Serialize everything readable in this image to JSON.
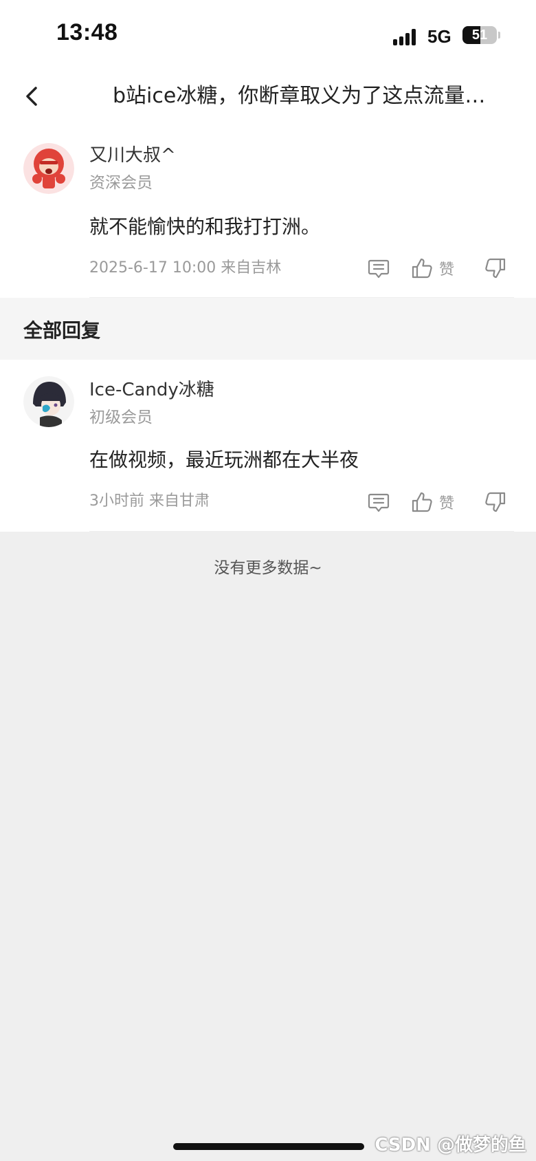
{
  "status_bar": {
    "time": "13:48",
    "network": "5G",
    "battery_level": "51",
    "battery_fraction": 0.51
  },
  "header": {
    "back_icon": "chevron-left-icon",
    "title": "b站ice冰糖，你断章取义为了这点流量…"
  },
  "main_comment": {
    "avatar_icon": "red-cartoon-avatar",
    "username": "又川大叔^",
    "member_level": "资深会员",
    "text": "就不能愉快的和我打打洲。",
    "meta": "2025-6-17 10:00  来自吉林",
    "reply_icon": "comment-icon",
    "like_icon": "thumbs-up-icon",
    "like_label": "赞",
    "dislike_icon": "thumbs-down-icon"
  },
  "replies_section": {
    "title": "全部回复"
  },
  "replies": [
    {
      "avatar_icon": "anime-girl-avatar",
      "username": "Ice-Candy冰糖",
      "member_level": "初级会员",
      "text": "在做视频，最近玩洲都在大半夜",
      "meta": "3小时前 来自甘肃",
      "reply_icon": "comment-icon",
      "like_icon": "thumbs-up-icon",
      "like_label": "赞",
      "dislike_icon": "thumbs-down-icon"
    }
  ],
  "footer": {
    "no_more_text": "没有更多数据~",
    "watermark": "CSDN @做梦的鱼"
  },
  "colors": {
    "page_background": "#efefef",
    "card_background": "#ffffff",
    "section_background": "#f5f5f5",
    "secondary_text": "#9a9a9a"
  }
}
